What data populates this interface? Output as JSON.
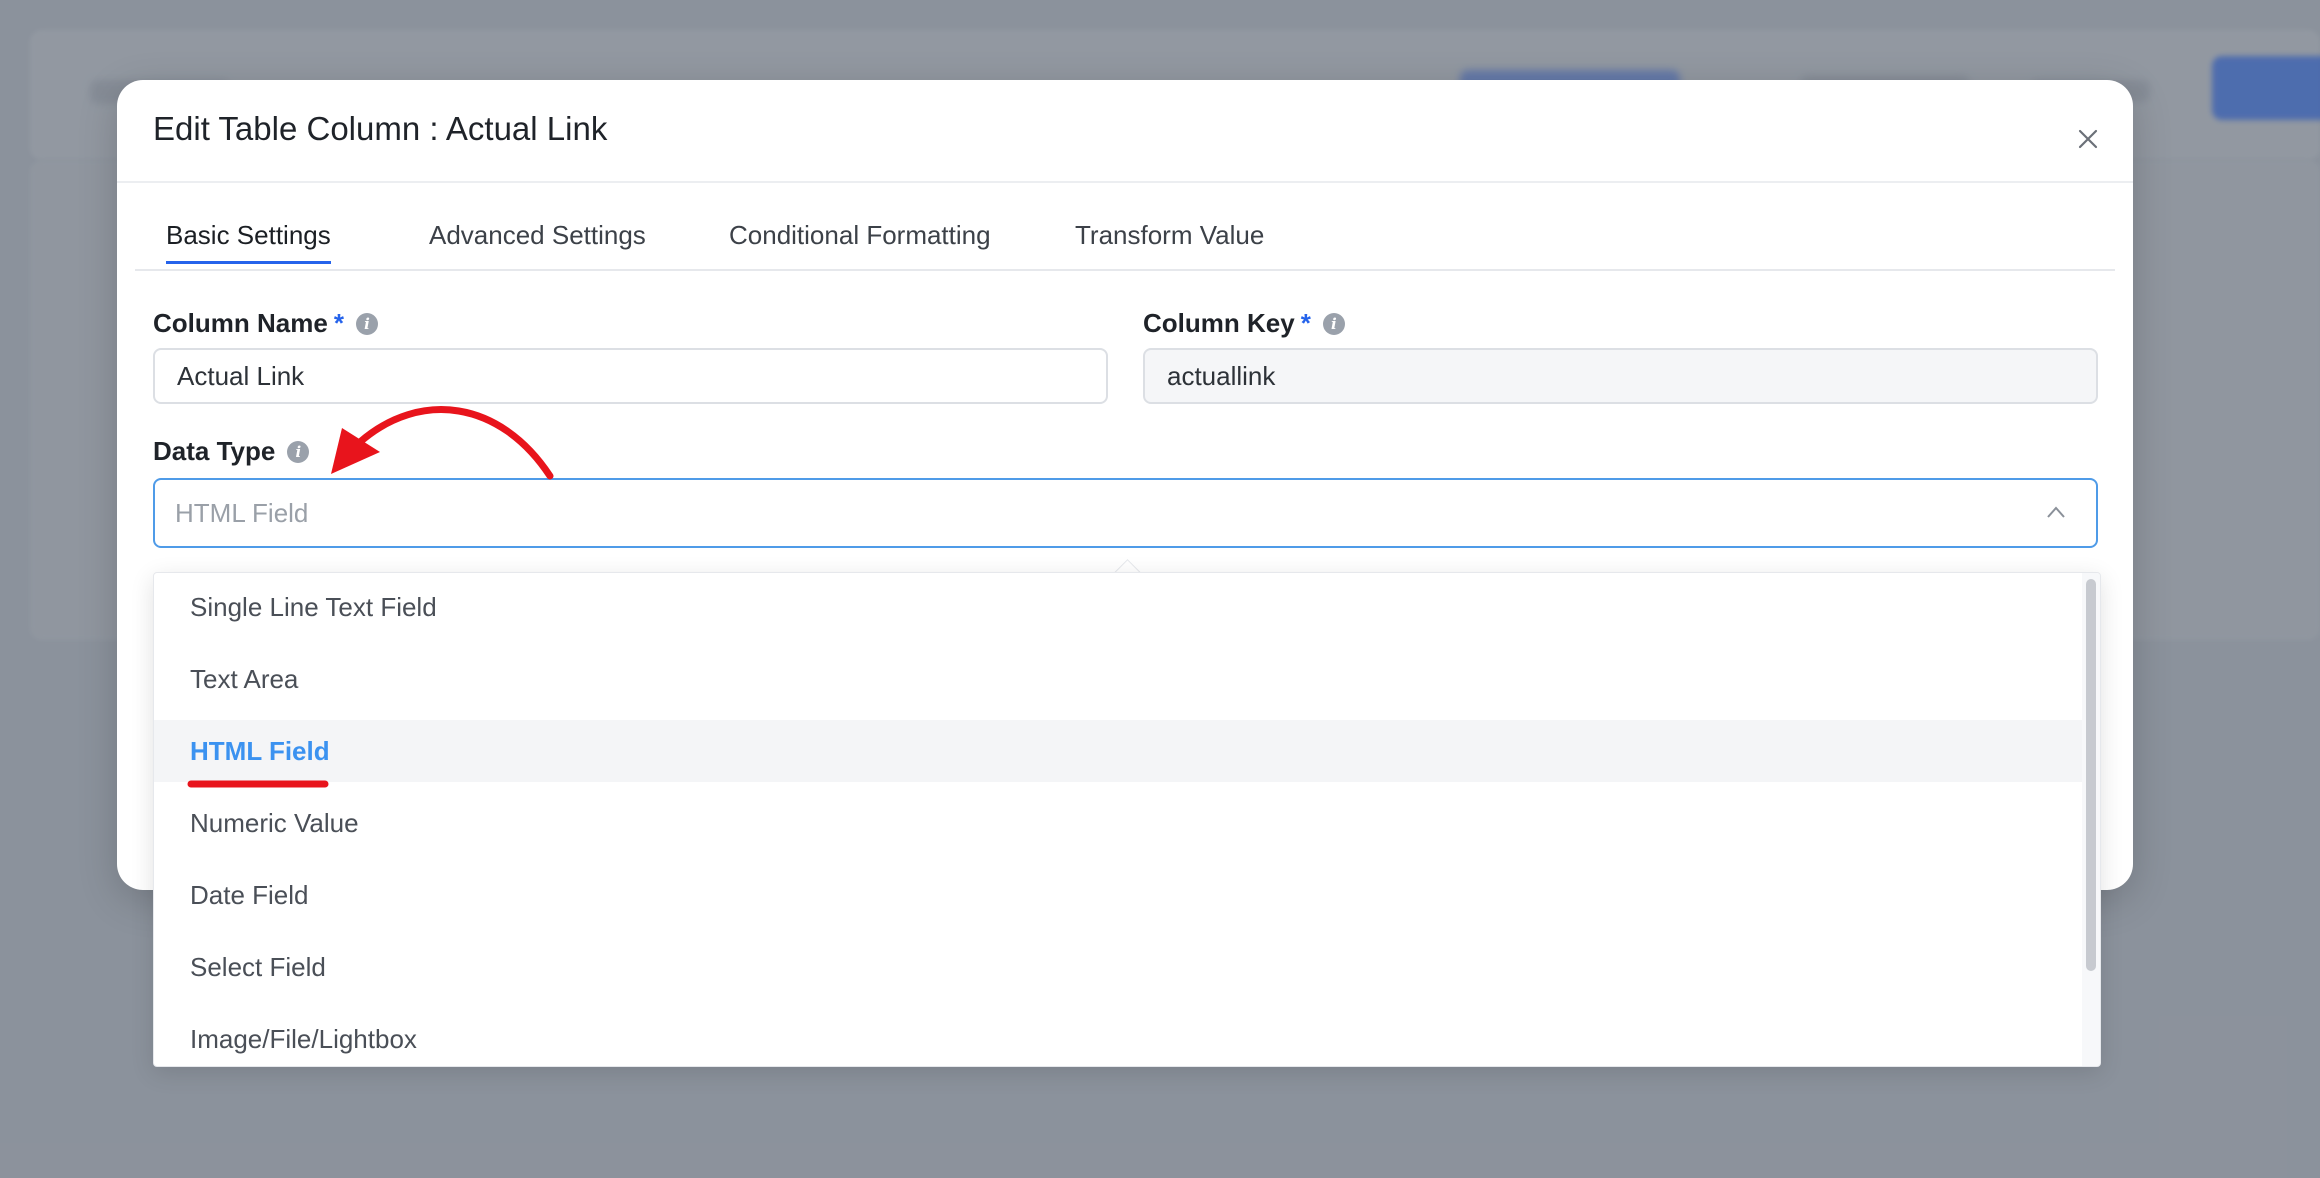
{
  "modal": {
    "title": "Edit Table Column : Actual Link"
  },
  "tabs": [
    {
      "label": "Basic Settings"
    },
    {
      "label": "Advanced Settings"
    },
    {
      "label": "Conditional Formatting"
    },
    {
      "label": "Transform Value"
    }
  ],
  "form": {
    "column_name_label": "Column Name",
    "column_name_value": "Actual Link",
    "column_key_label": "Column Key",
    "column_key_value": "actuallink",
    "required_mark": "*",
    "data_type_label": "Data Type",
    "data_type_value": "HTML Field"
  },
  "dropdown": {
    "options": [
      {
        "label": "Single Line Text Field"
      },
      {
        "label": "Text Area"
      },
      {
        "label": "HTML Field"
      },
      {
        "label": "Numeric Value"
      },
      {
        "label": "Date Field"
      },
      {
        "label": "Select Field"
      },
      {
        "label": "Image/File/Lightbox"
      }
    ]
  },
  "colors": {
    "accent": "#2563eb",
    "selected_option": "#3b92f0",
    "annotation": "#e8141c"
  },
  "icons": [
    "close-icon",
    "info-icon",
    "chevron-up-icon",
    "annotation-arrow",
    "annotation-underline"
  ]
}
